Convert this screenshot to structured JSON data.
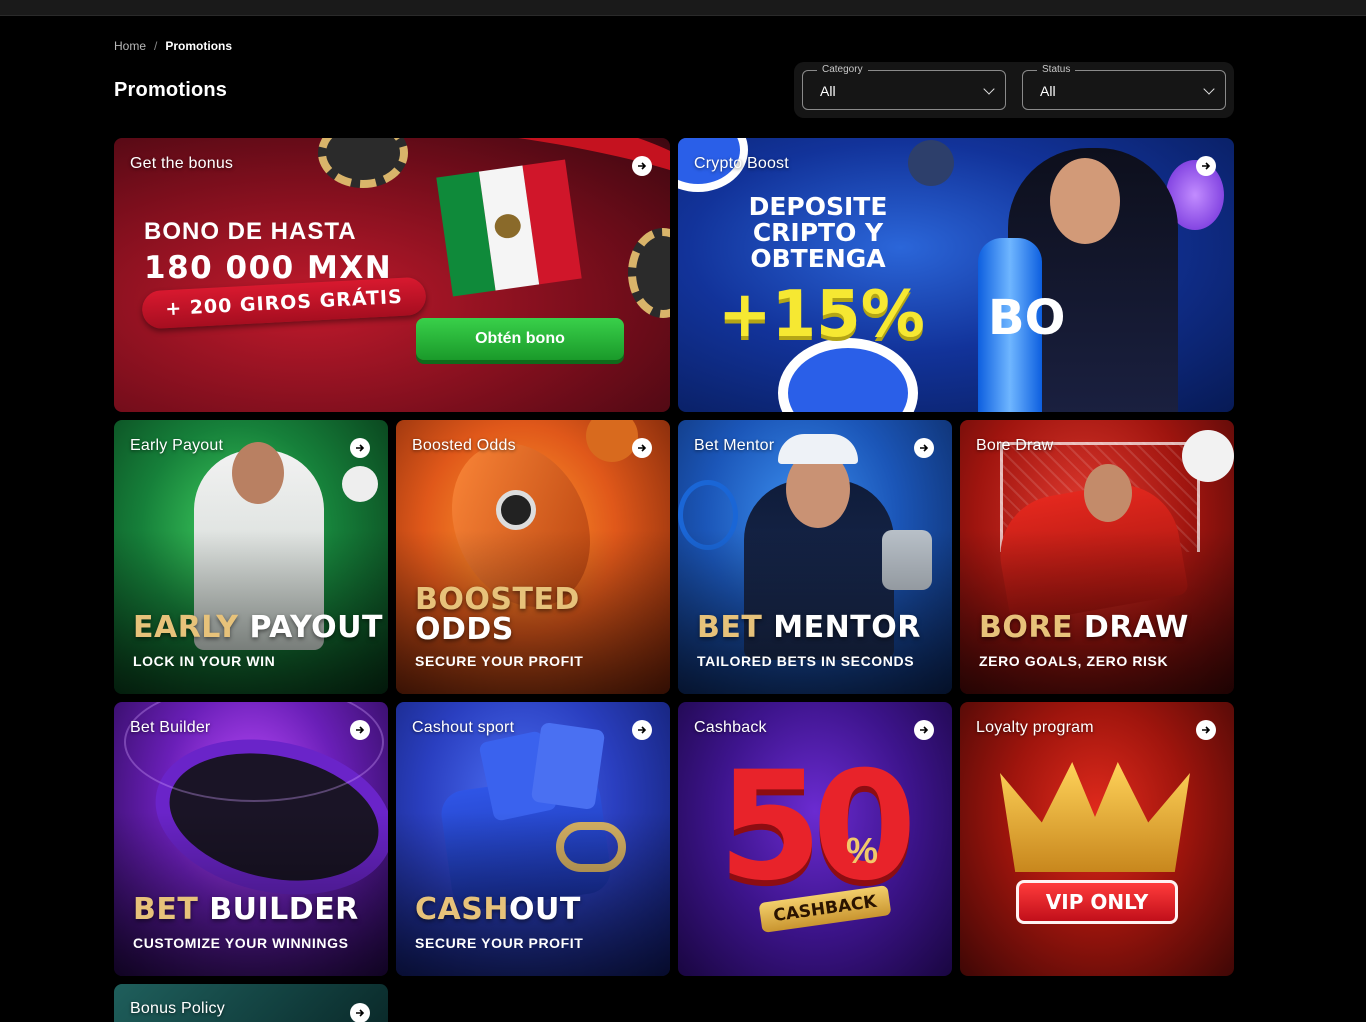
{
  "breadcrumb": {
    "home": "Home",
    "separator": "/",
    "current": "Promotions"
  },
  "page_title": "Promotions",
  "filters": {
    "category": {
      "label": "Category",
      "value": "All"
    },
    "status": {
      "label": "Status",
      "value": "All"
    }
  },
  "cards": {
    "bonus": {
      "title": "Get the bonus",
      "line1": "BONO DE HASTA",
      "line2": "180 000 MXN",
      "pill": "+ 200 GIROS GRÁTIS",
      "button": "Obtén bono"
    },
    "crypto": {
      "title": "Crypto Boost",
      "text": "DEPOSITE CRIPTO Y OBTENGA",
      "percent": "+15%",
      "bottle": "BO"
    },
    "early": {
      "title": "Early Payout",
      "head_gold": "EARLY",
      "head_white": "PAYOUT",
      "sub": "LOCK IN YOUR WIN"
    },
    "boosted": {
      "title": "Boosted Odds",
      "head_gold": "BOOSTED",
      "head_white": "ODDS",
      "sub": "SECURE YOUR PROFIT"
    },
    "mentor": {
      "title": "Bet Mentor",
      "head_gold": "BET",
      "head_white": "MENTOR",
      "sub": "TAILORED BETS IN SECONDS"
    },
    "bore": {
      "title": "Bore Draw",
      "head_gold": "BORE",
      "head_white": "DRAW",
      "sub": "ZERO GOALS, ZERO RISK"
    },
    "builder": {
      "title": "Bet Builder",
      "head_gold": "BET",
      "head_white": "BUILDER",
      "sub": "CUSTOMIZE YOUR WINNINGS"
    },
    "cashout": {
      "title": "Cashout sport",
      "head_gold": "CASH",
      "head_white": "OUT",
      "sub": "SECURE YOUR PROFIT"
    },
    "cashback": {
      "title": "Cashback",
      "number": "50",
      "percent_sign": "%",
      "ribbon": "CASHBACK"
    },
    "loyalty": {
      "title": "Loyalty program",
      "badge": "VIP ONLY"
    },
    "policy": {
      "title": "Bonus Policy"
    }
  },
  "colors": {
    "background": "#000000",
    "accent_gold": "#e7c27a",
    "crypto_yellow": "#f6e832",
    "bonus_green": "#39d04a"
  },
  "icons": {
    "card_arrow": "arrow-right-circle-icon",
    "select_chevron": "chevron-down-icon"
  }
}
